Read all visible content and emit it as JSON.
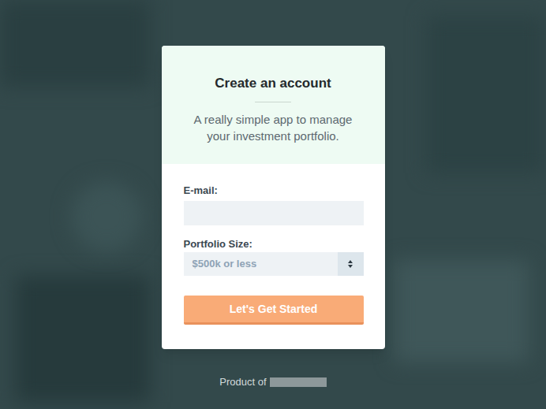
{
  "card": {
    "title": "Create an account",
    "subtitle": "A really simple app to manage your investment portfolio."
  },
  "form": {
    "email": {
      "label": "E-mail:",
      "value": ""
    },
    "portfolio": {
      "label": "Portfolio Size:",
      "value": "$500k or less"
    },
    "submit": "Let's Get Started"
  },
  "footer": {
    "text": "Product of"
  }
}
